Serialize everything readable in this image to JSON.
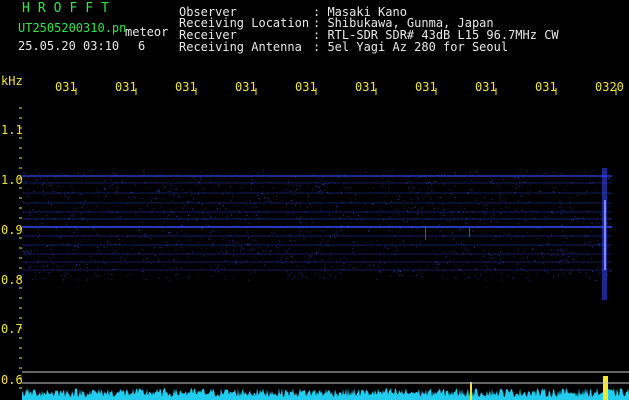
{
  "header": {
    "brand": "HROFFT",
    "filename": "UT2505200310.pn",
    "mode": "meteor",
    "datetime": "25.05.20 03:10",
    "count": "6",
    "info_labels": [
      "Observer",
      "Receiving Location",
      "Receiver",
      "Receiving Antenna"
    ],
    "info_values": [
      ": Masaki Kano",
      ": Shibukawa, Gunma, Japan",
      ": RTL-SDR SDR# 43dB L15 96.7MHz CW",
      ": 5el Yagi Az 280 for Seoul"
    ]
  },
  "axis": {
    "unit": "kHz",
    "time_ticks": [
      "031",
      "031",
      "031",
      "031",
      "031",
      "031",
      "031",
      "031",
      "031",
      "0320"
    ],
    "freq_ticks": [
      "1.1",
      "1.0",
      "0.9",
      "0.8",
      "0.7",
      "0.6"
    ]
  },
  "colors": {
    "background": "#000000",
    "header_green": "#2ee64a",
    "header_white": "#e8e8e8",
    "tick_yellow": "#f2e62e",
    "signal_blue": "#2f4dff",
    "level_cyan": "#22ccee"
  }
}
